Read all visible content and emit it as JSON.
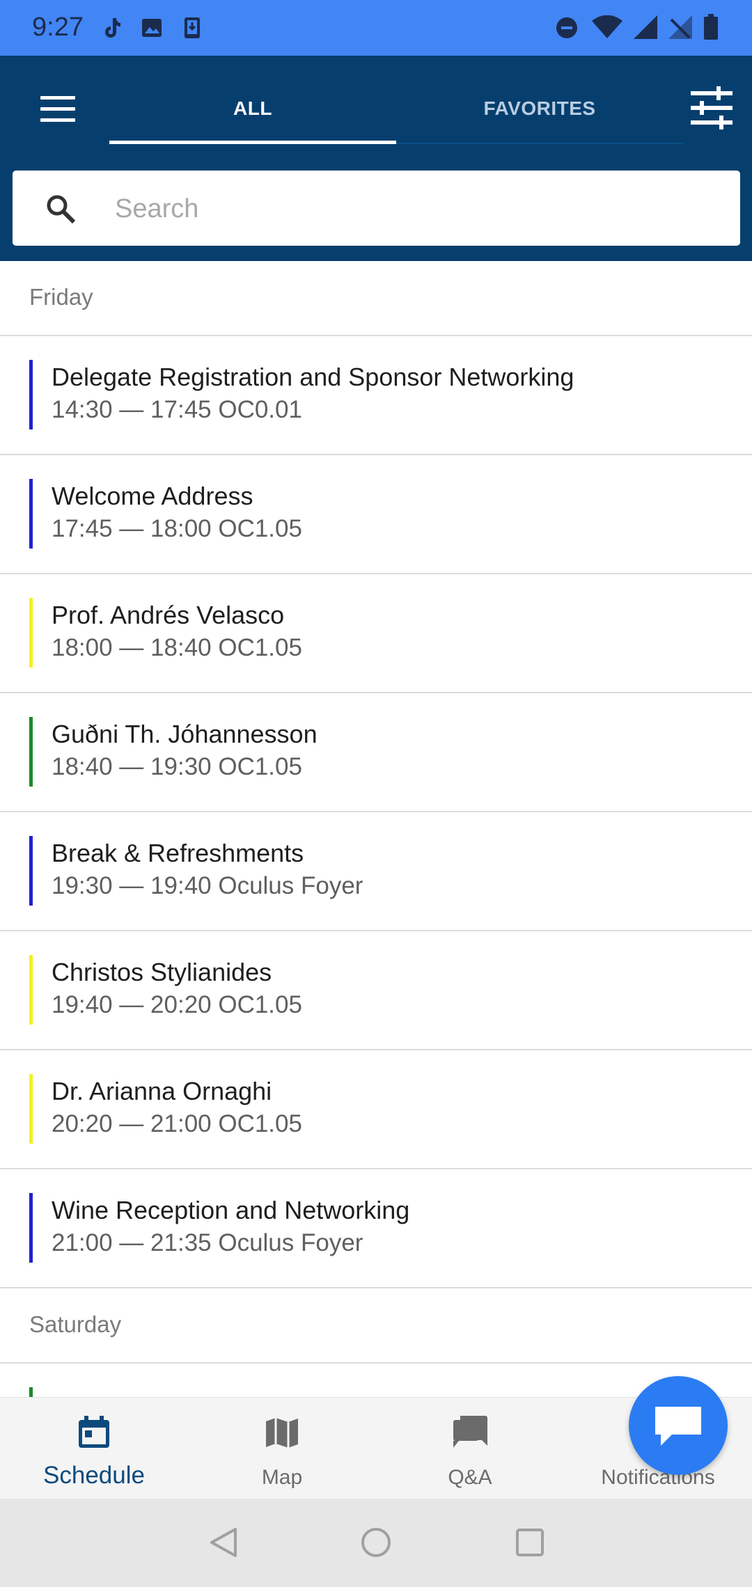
{
  "status_bar": {
    "time": "9:27",
    "left_icons": [
      "tiktok-icon",
      "image-icon",
      "download-icon"
    ],
    "right_icons": [
      "dnd-icon",
      "wifi-icon",
      "signal-icon",
      "no-signal-icon",
      "battery-icon"
    ]
  },
  "app_bar": {
    "tabs": [
      {
        "label": "ALL",
        "active": true
      },
      {
        "label": "FAVORITES",
        "active": false
      }
    ],
    "search": {
      "placeholder": "Search",
      "value": ""
    }
  },
  "schedule": {
    "days": [
      {
        "label": "Friday",
        "sessions": [
          {
            "title": "Delegate Registration and Sponsor Networking",
            "time": "14:30 — 17:45 OC0.01",
            "color": "#2020d0"
          },
          {
            "title": "Welcome Address",
            "time": "17:45 — 18:00 OC1.05",
            "color": "#2020d0"
          },
          {
            "title": "Prof. Andrés Velasco",
            "time": "18:00 — 18:40 OC1.05",
            "color": "#f2f21e"
          },
          {
            "title": "Guðni Th. Jóhannesson",
            "time": "18:40 — 19:30 OC1.05",
            "color": "#1a8a2a"
          },
          {
            "title": "Break & Refreshments",
            "time": "19:30 — 19:40 Oculus Foyer",
            "color": "#2020d0"
          },
          {
            "title": "Christos Stylianides",
            "time": "19:40 — 20:20 OC1.05",
            "color": "#f2f21e"
          },
          {
            "title": "Dr. Arianna Ornaghi",
            "time": "20:20 — 21:00 OC1.05",
            "color": "#f2f21e"
          },
          {
            "title": "Wine Reception and Networking",
            "time": "21:00 — 21:35 Oculus Foyer",
            "color": "#2020d0"
          }
        ]
      },
      {
        "label": "Saturday",
        "sessions": []
      }
    ]
  },
  "bottom_nav": {
    "items": [
      {
        "label": "Schedule",
        "icon": "calendar-icon",
        "active": true
      },
      {
        "label": "Map",
        "icon": "map-icon",
        "active": false
      },
      {
        "label": "Q&A",
        "icon": "chat-icon",
        "active": false
      },
      {
        "label": "Notifications",
        "icon": "bell-icon",
        "active": false
      }
    ]
  },
  "fab": {
    "icon": "message-icon"
  },
  "colors": {
    "status_bar": "#4285f4",
    "app_bar": "#063f6e",
    "active_nav": "#0b4a7d",
    "fab": "#2b7cf3"
  }
}
